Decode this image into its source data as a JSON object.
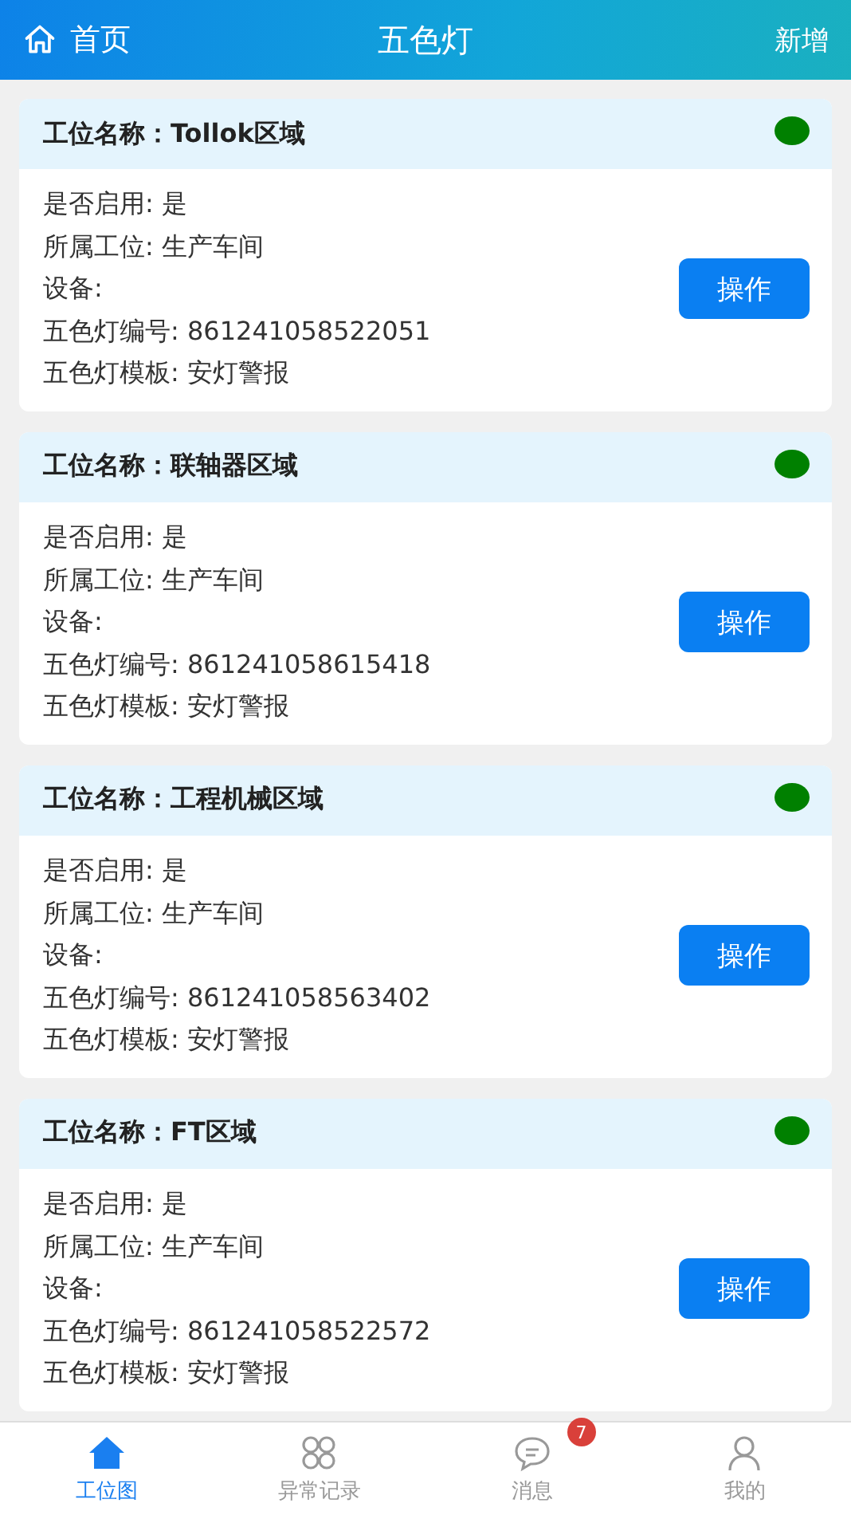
{
  "header": {
    "back_label": "首页",
    "title": "五色灯",
    "action": "新增"
  },
  "cards": [
    {
      "title_label": "工位名称：",
      "name": "Tollok区域",
      "color": "#008000",
      "lines": [
        "是否启用: 是",
        "所属工位: 生产车间",
        "设备:",
        "五色灯编号: 861241058522051",
        "五色灯模板: 安灯警报"
      ],
      "button": "操作"
    },
    {
      "title_label": "工位名称：",
      "name": "联轴器区域",
      "color": "#008000",
      "lines": [
        "是否启用: 是",
        "所属工位: 生产车间",
        "设备:",
        "五色灯编号: 861241058615418",
        "五色灯模板: 安灯警报"
      ],
      "button": "操作"
    },
    {
      "title_label": "工位名称：",
      "name": "工程机械区域",
      "color": "#008000",
      "lines": [
        "是否启用: 是",
        "所属工位: 生产车间",
        "设备:",
        "五色灯编号: 861241058563402",
        "五色灯模板: 安灯警报"
      ],
      "button": "操作"
    },
    {
      "title_label": "工位名称：",
      "name": "FT区域",
      "color": "#008000",
      "lines": [
        "是否启用: 是",
        "所属工位: 生产车间",
        "设备:",
        "五色灯编号: 861241058522572",
        "五色灯模板: 安灯警报"
      ],
      "button": "操作"
    }
  ],
  "tabbar": [
    {
      "kind": "home",
      "label": "工位图",
      "selected": true
    },
    {
      "kind": "grid",
      "label": "异常记录",
      "selected": false
    },
    {
      "kind": "chat",
      "label": "消息",
      "selected": false,
      "badge": "7"
    },
    {
      "kind": "person",
      "label": "我的",
      "selected": false
    }
  ]
}
